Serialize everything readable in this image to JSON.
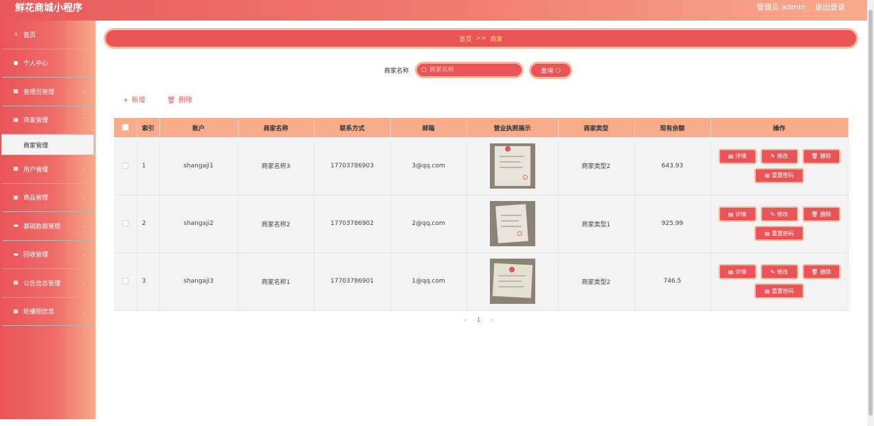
{
  "header": {
    "title": "鲜花商城小程序",
    "user": "管理员 admin",
    "logout": "退出登录"
  },
  "sidebar": {
    "items": [
      {
        "label": "首页",
        "icon": "home-icon"
      },
      {
        "label": "个人中心",
        "icon": "person-icon"
      },
      {
        "label": "管理员管理",
        "icon": "grid-icon"
      },
      {
        "label": "商家管理",
        "icon": "grid-icon",
        "expanded": true,
        "sub": "商家管理"
      },
      {
        "label": "用户管理",
        "icon": "grid-icon"
      },
      {
        "label": "商品管理",
        "icon": "bag-icon"
      },
      {
        "label": "基础数据管理",
        "icon": "monitor-icon"
      },
      {
        "label": "回收管理",
        "icon": "monitor-icon"
      },
      {
        "label": "公告信息管理",
        "icon": "grid-icon"
      },
      {
        "label": "轮播图信息",
        "icon": "grid-icon"
      }
    ]
  },
  "breadcrumb": {
    "home": "首页",
    "sep": ">>",
    "current": "商家"
  },
  "search": {
    "label": "商家名称",
    "placeholder": "商家名称",
    "button": "查询"
  },
  "actions": {
    "add": "新增",
    "delete": "删除"
  },
  "table": {
    "headers": [
      "索引",
      "账户",
      "商家名称",
      "联系方式",
      "邮箱",
      "营业执照展示",
      "商家类型",
      "现有余额",
      "操作"
    ],
    "rows": [
      {
        "index": "1",
        "account": "shangaji1",
        "name": "商家名称3",
        "phone": "17703786903",
        "email": "3@qq.com",
        "type": "商家类型2",
        "balance": "643.93"
      },
      {
        "index": "2",
        "account": "shangaji2",
        "name": "商家名称2",
        "phone": "17703786902",
        "email": "2@qq.com",
        "type": "商家类型1",
        "balance": "925.99"
      },
      {
        "index": "3",
        "account": "shangaji3",
        "name": "商家名称1",
        "phone": "17703786901",
        "email": "1@qq.com",
        "type": "商家类型2",
        "balance": "746.5"
      }
    ],
    "ops": {
      "detail": "详情",
      "edit": "修改",
      "delete": "删除",
      "reset": "重置密码"
    }
  },
  "pagination": {
    "prev": "‹",
    "current": "1",
    "next": "›"
  },
  "colors": {
    "primary": "#ea5458",
    "accent": "#f8b797",
    "header": "#f7ad8b"
  }
}
